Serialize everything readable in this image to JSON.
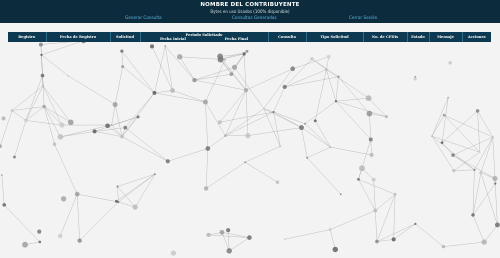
{
  "header": {
    "title": "NOMBRE DEL CONTRIBUYENTE",
    "subtitle": "Bytes en uso Usados (100% disponible)",
    "nav": {
      "generar": "Generar Consulta",
      "consultas": "Consultas Generadas",
      "cerrar": "Cerrar Sesión"
    }
  },
  "table": {
    "columns": {
      "registro": "Registro",
      "fecha_registro": "Fecha de Registro",
      "solicitud": "Solicitud",
      "periodo": "Periodo Solicitado",
      "fecha_inicial": "Fecha Inicial",
      "fecha_final": "Fecha Final",
      "consulta": "Consulta",
      "tipo_solicitud": "Tipo Solicitud",
      "cfdis": "No. de CFDIs",
      "estado": "Estado",
      "mensaje": "Mensaje",
      "acciones": "Acciones"
    }
  },
  "colors": {
    "header_bg": "#0c2c3d",
    "table_header_bg": "#0d3a52",
    "link": "#5fb3e3",
    "page_bg": "#f3f3f3"
  }
}
